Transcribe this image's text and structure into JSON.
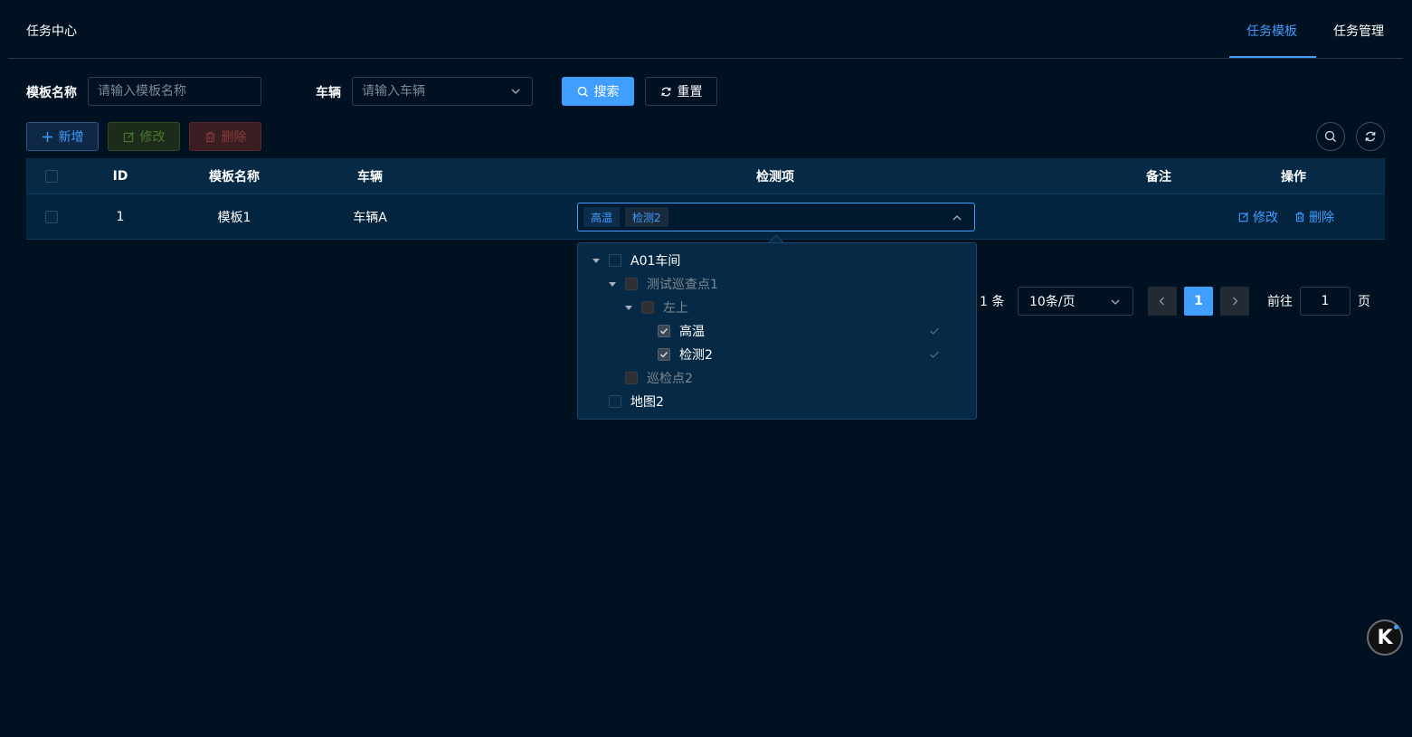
{
  "header": {
    "title": "任务中心",
    "tabs": [
      {
        "label": "任务模板",
        "active": true
      },
      {
        "label": "任务管理",
        "active": false
      }
    ]
  },
  "search": {
    "template_name_label": "模板名称",
    "template_name_placeholder": "请输入模板名称",
    "vehicle_label": "车辆",
    "vehicle_placeholder": "请输入车辆",
    "search_button": "搜索",
    "reset_button": "重置"
  },
  "toolbar": {
    "add_label": "新增",
    "edit_label": "修改",
    "delete_label": "删除",
    "search_icon": "search-icon",
    "refresh_icon": "refresh-icon"
  },
  "table": {
    "columns": [
      "ID",
      "模板名称",
      "车辆",
      "检测项",
      "备注",
      "操作"
    ],
    "rows": [
      {
        "id": "1",
        "template_name": "模板1",
        "vehicle": "车辆A",
        "detection_tags": [
          "高温",
          "检测2"
        ],
        "remark": "",
        "actions": {
          "edit": "修改",
          "delete": "删除"
        }
      }
    ]
  },
  "tree_dropdown": {
    "nodes": [
      {
        "label": "A01车间",
        "level": 0,
        "expanded": true,
        "checked": false,
        "dim": false
      },
      {
        "label": "测试巡查点1",
        "level": 1,
        "expanded": true,
        "checked": false,
        "dim": true
      },
      {
        "label": "左上",
        "level": 2,
        "expanded": true,
        "checked": false,
        "dim": true
      },
      {
        "label": "高温",
        "level": 3,
        "checked": true,
        "dim": false
      },
      {
        "label": "检测2",
        "level": 3,
        "checked": true,
        "dim": false
      },
      {
        "label": "巡检点2",
        "level": 1,
        "checked": false,
        "dim": true
      },
      {
        "label": "地图2",
        "level": 0,
        "checked": false,
        "dim": false
      }
    ]
  },
  "pagination": {
    "total_text": "1 条",
    "page_size": "10条/页",
    "current_page": "1",
    "goto_label": "前往",
    "goto_value": "1",
    "page_suffix": "页"
  },
  "colors": {
    "background": "#001122",
    "accent": "#409eff",
    "table_header": "#062a45",
    "table_row": "#03243f"
  }
}
